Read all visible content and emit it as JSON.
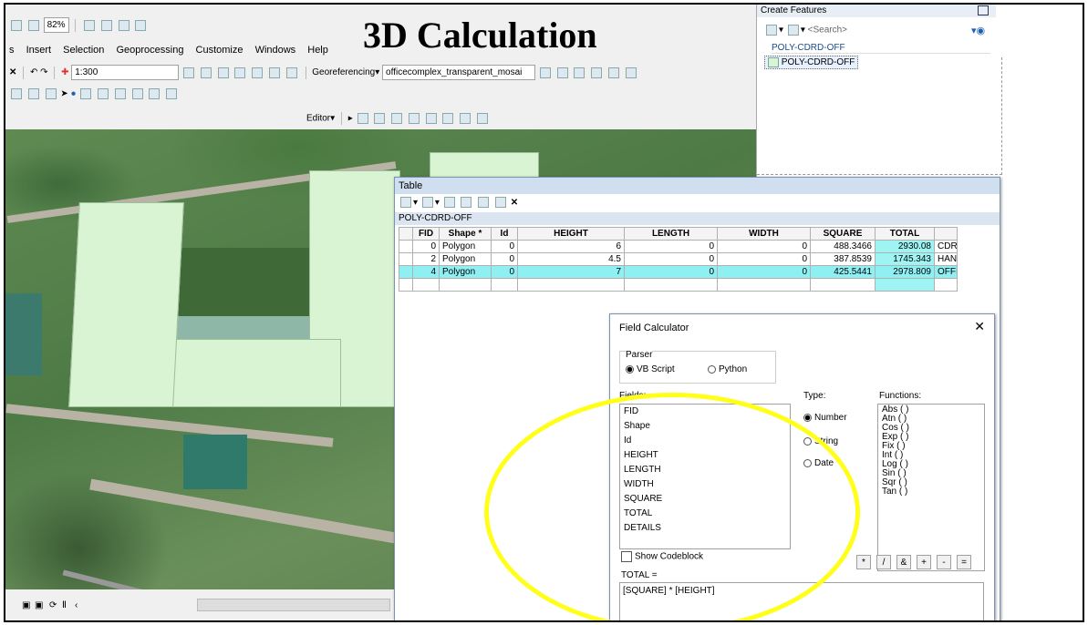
{
  "headline": "3D Calculation",
  "toolbar": {
    "zoom_percent": "82%",
    "scale": "1:300",
    "georeferencing_label": "Georeferencing",
    "georef_layer": "officecomplex_transparent_mosai",
    "editor_label": "Editor"
  },
  "menu": [
    "s",
    "Insert",
    "Selection",
    "Geoprocessing",
    "Customize",
    "Windows",
    "Help"
  ],
  "create_features": {
    "title": "Create Features",
    "search_placeholder": "<Search>",
    "layer_group": "POLY-CDRD-OFF",
    "template": "POLY-CDRD-OFF"
  },
  "table_window": {
    "title": "Table",
    "layer_tab": "POLY-CDRD-OFF",
    "columns": [
      "FID",
      "Shape *",
      "Id",
      "HEIGHT",
      "LENGTH",
      "WIDTH",
      "SQUARE",
      "TOTAL",
      ""
    ],
    "rows": [
      {
        "fid": "0",
        "shape": "Polygon",
        "id": "0",
        "height": "6",
        "length": "0",
        "width": "0",
        "square": "488.3466",
        "total": "2930.08",
        "details": "CDRI"
      },
      {
        "fid": "2",
        "shape": "Polygon",
        "id": "0",
        "height": "4.5",
        "length": "0",
        "width": "0",
        "square": "387.8539",
        "total": "1745.343",
        "details": "HANC"
      },
      {
        "fid": "4",
        "shape": "Polygon",
        "id": "0",
        "height": "7",
        "length": "0",
        "width": "0",
        "square": "425.5441",
        "total": "2978.809",
        "details": "OFFI"
      }
    ]
  },
  "field_calculator": {
    "title": "Field Calculator",
    "close_glyph": "✕",
    "parser_label": "Parser",
    "parser_vbscript": "VB Script",
    "parser_python": "Python",
    "fields_label": "Fields:",
    "fields": [
      "FID",
      "Shape",
      "Id",
      "HEIGHT",
      "LENGTH",
      "WIDTH",
      "SQUARE",
      "TOTAL",
      "DETAILS"
    ],
    "type_label": "Type:",
    "type_number": "Number",
    "type_string": "String",
    "type_date": "Date",
    "functions_label": "Functions:",
    "functions": [
      "Abs ( )",
      "Atn ( )",
      "Cos ( )",
      "Exp ( )",
      "Fix ( )",
      "Int ( )",
      "Log ( )",
      "Sin ( )",
      "Sqr ( )",
      "Tan ( )"
    ],
    "show_codeblock": "Show Codeblock",
    "expression_label": "TOTAL =",
    "expression": "[SQUARE] * [HEIGHT]",
    "operators": [
      "*",
      "/",
      "&",
      "+",
      "-",
      "="
    ]
  },
  "colors": {
    "highlight_ellipse": "#ffff1a",
    "selected_row": "#8ff0f4",
    "building_fill": "#d8f4d3"
  }
}
